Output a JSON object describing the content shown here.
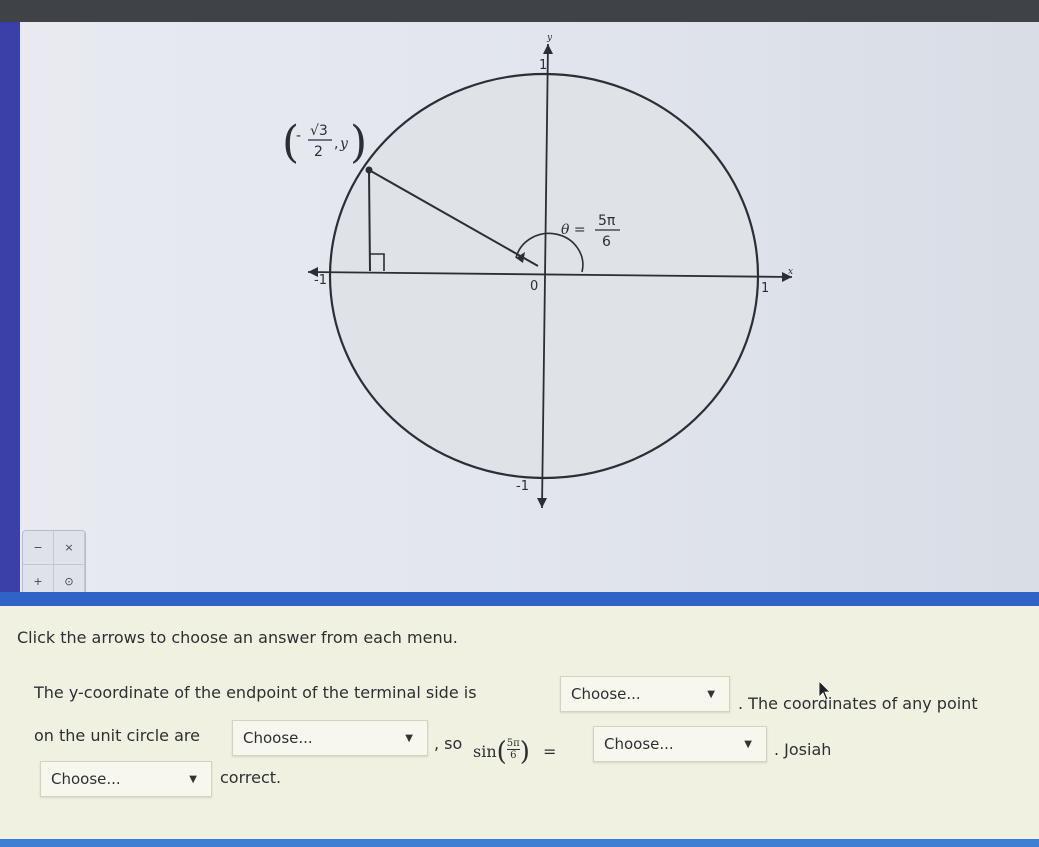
{
  "figure": {
    "point_label_x_num": "√3",
    "point_label_x_den": "2",
    "point_label_y": "y",
    "theta_label": "θ =",
    "theta_num": "5π",
    "theta_den": "6",
    "origin_label": "0",
    "axis_pos_x": "1",
    "axis_neg_x": "-1",
    "axis_pos_y": "1",
    "axis_neg_y": "-1",
    "x_axis_name": "x",
    "y_axis_name": "y"
  },
  "zoom_tool": {
    "zoom_out": "−",
    "close": "×",
    "zoom_in": "+",
    "reset": "⊙"
  },
  "question": {
    "instruction": "Click the arrows to choose an answer from each menu.",
    "sentence_1a": "The y-coordinate of the endpoint of the terminal side is",
    "sentence_1b": ". The coordinates of any point",
    "sentence_2a": "on the unit circle are",
    "sentence_2b": ", so",
    "sin_expr_fn": "sin",
    "sin_expr_num": "5π",
    "sin_expr_den": "6",
    "equals": "=",
    "sentence_2c": ". Josiah",
    "sentence_3": "correct."
  },
  "selects": [
    {
      "value": "Choose..."
    },
    {
      "value": "Choose..."
    },
    {
      "value": "Choose..."
    },
    {
      "value": "Choose..."
    }
  ],
  "colors": {
    "accent_blue": "#2f63c8",
    "circle_fill": "#dfe2e6",
    "panel_bg": "#f1f1e2"
  }
}
